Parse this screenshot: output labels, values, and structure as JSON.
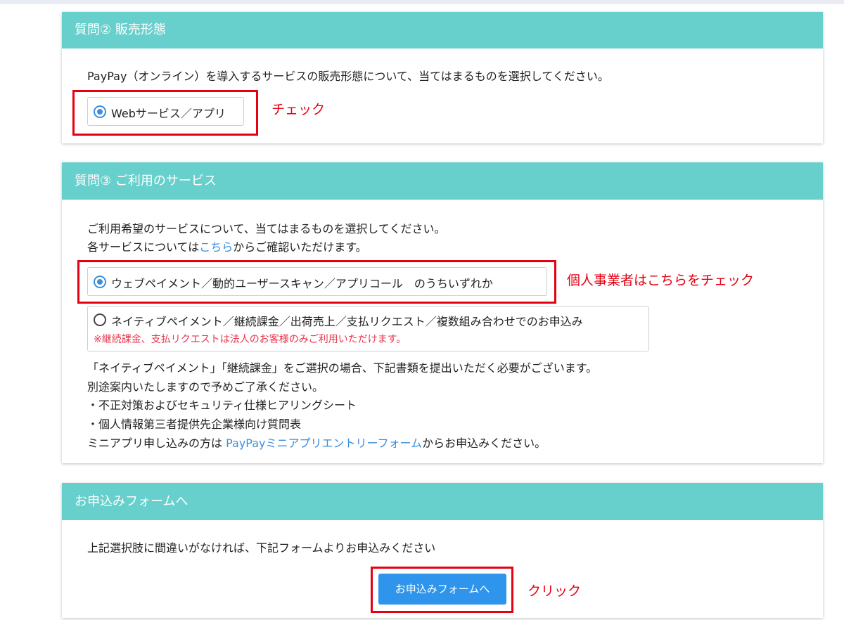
{
  "q2": {
    "title": "質問② 販売形態",
    "description": "PayPay（オンライン）を導入するサービスの販売形態について、当てはまるものを選択してください。",
    "option_label": "Webサービス／アプリ",
    "annotation": "チェック"
  },
  "q3": {
    "title": "質問③ ご利用のサービス",
    "intro_line1": "ご利用希望のサービスについて、当てはまるものを選択してください。",
    "intro_line2_prefix": "各サービスについては",
    "intro_line2_link": "こちら",
    "intro_line2_suffix": "からご確認いただけます。",
    "option1_label": "ウェブペイメント／動的ユーザースキャン／アプリコール　のうちいずれか",
    "option1_annotation": "個人事業者はこちらをチェック",
    "option2_label": "ネイティブペイメント／継続課金／出荷売上／支払リクエスト／複数組み合わせでのお申込み",
    "option2_note": "※継続課金、支払リクエストは法人のお客様のみご利用いただけます。",
    "info_line1": "「ネイティブペイメント」「継続課金」をご選択の場合、下記書類を提出いただく必要がございます。",
    "info_line2": "別途案内いたしますので予めご了承ください。",
    "doc1": "・不正対策およびセキュリティ仕様ヒアリングシート",
    "doc2": "・個人情報第三者提供先企業様向け質問表",
    "mini_prefix": "ミニアプリ申し込みの方は ",
    "mini_link": "PayPayミニアプリエントリーフォーム",
    "mini_suffix": "からお申込みください。"
  },
  "apply": {
    "title": "お申込みフォームへ",
    "description": "上記選択肢に間違いがなければ、下記フォームよりお申込みください",
    "button_label": "お申込みフォームへ",
    "annotation": "クリック"
  },
  "colors": {
    "header_bg": "#67cfcc",
    "accent_blue": "#2f95ec",
    "annotation_red": "#e60012",
    "note_pink": "#e8344a"
  }
}
